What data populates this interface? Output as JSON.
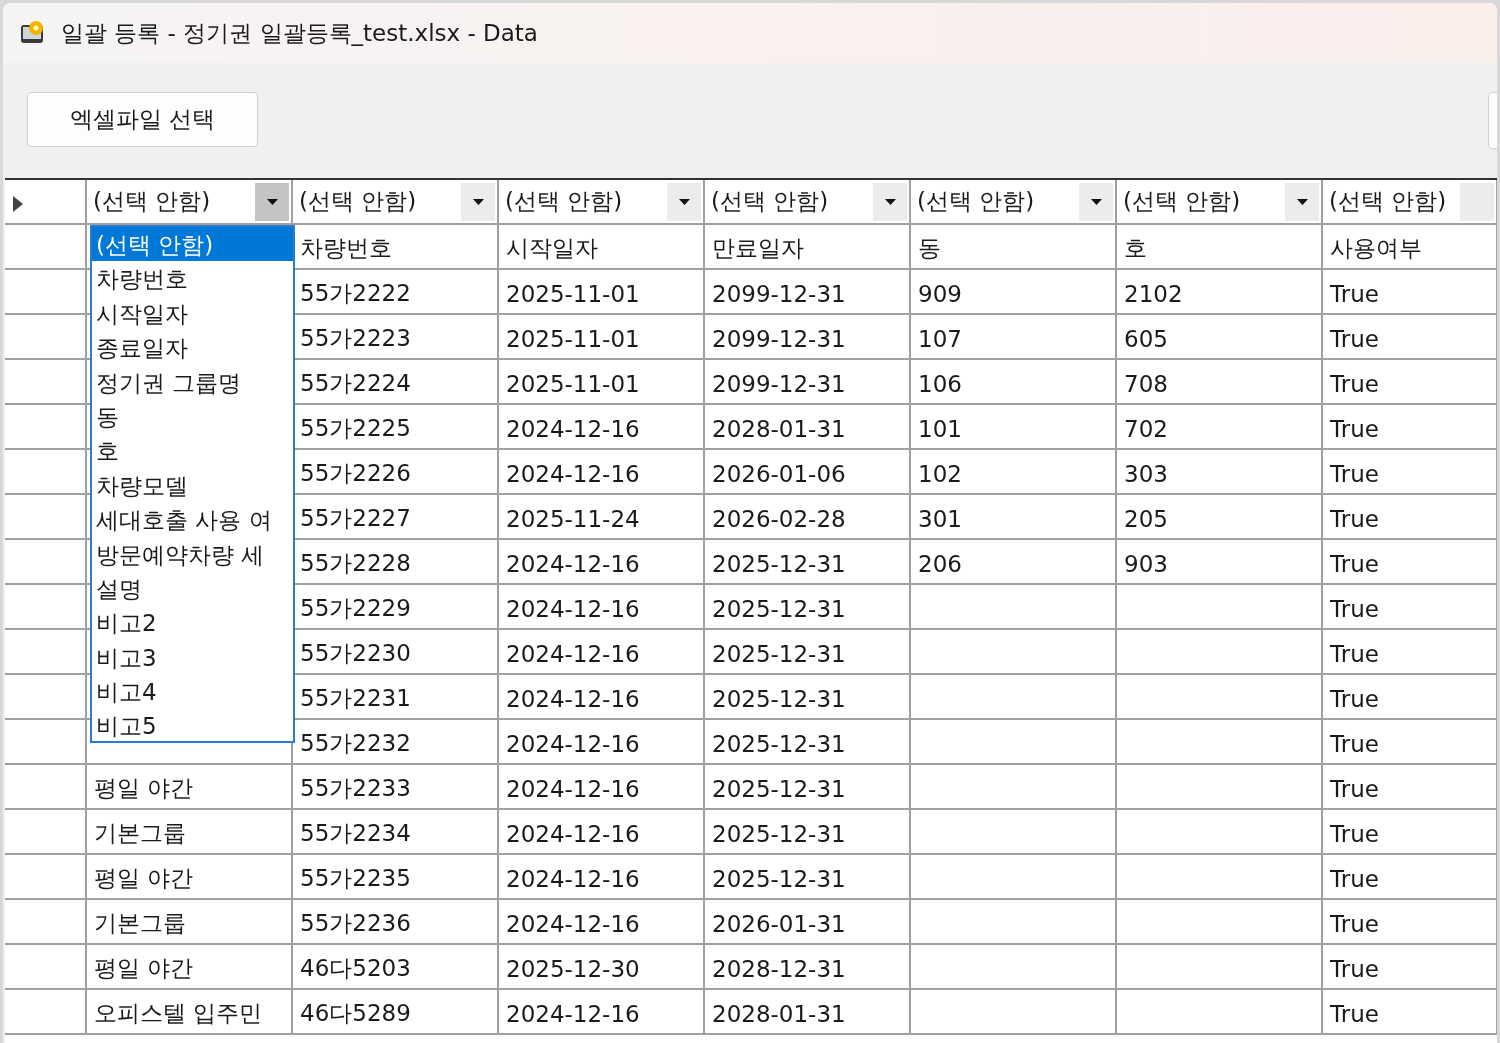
{
  "window": {
    "title": "일괄 등록 - 정기권 일괄등록_test.xlsx - Data"
  },
  "toolbar": {
    "button": "엑셀파일 선택"
  },
  "grid": {
    "combo_row": {
      "current": true,
      "combos": [
        {
          "text": "(선택 안함)",
          "open": true,
          "cut": false
        },
        {
          "text": "(선택 안함)",
          "open": false,
          "cut": false
        },
        {
          "text": "(선택 안함)",
          "open": false,
          "cut": false
        },
        {
          "text": "(선택 안함)",
          "open": false,
          "cut": false
        },
        {
          "text": "(선택 안함)",
          "open": false,
          "cut": false
        },
        {
          "text": "(선택 안함)",
          "open": false,
          "cut": false
        },
        {
          "text": "(선택 안함)",
          "open": false,
          "cut": true
        }
      ]
    },
    "rows": [
      {
        "cells": [
          "차량번호",
          "시작일자",
          "만료일자",
          "동",
          "호",
          "사용여부"
        ]
      },
      {
        "cells": [
          "55가2222",
          "2025-11-01",
          "2099-12-31",
          "909",
          "2102",
          "True"
        ]
      },
      {
        "cells": [
          "55가2223",
          "2025-11-01",
          "2099-12-31",
          "107",
          "605",
          "True"
        ]
      },
      {
        "cells": [
          "55가2224",
          "2025-11-01",
          "2099-12-31",
          "106",
          "708",
          "True"
        ]
      },
      {
        "cells": [
          "55가2225",
          "2024-12-16",
          "2028-01-31",
          "101",
          "702",
          "True"
        ]
      },
      {
        "cells": [
          "55가2226",
          "2024-12-16",
          "2026-01-06",
          "102",
          "303",
          "True"
        ]
      },
      {
        "cells": [
          "55가2227",
          "2025-11-24",
          "2026-02-28",
          "301",
          "205",
          "True"
        ]
      },
      {
        "cells": [
          "55가2228",
          "2024-12-16",
          "2025-12-31",
          "206",
          "903",
          "True"
        ]
      },
      {
        "cells": [
          "55가2229",
          "2024-12-16",
          "2025-12-31",
          null,
          null,
          "True"
        ]
      },
      {
        "cells": [
          "55가2230",
          "2024-12-16",
          "2025-12-31",
          null,
          null,
          "True"
        ]
      },
      {
        "cells": [
          "55가2231",
          "2024-12-16",
          "2025-12-31",
          null,
          null,
          "True"
        ]
      },
      {
        "cells": [
          "55가2232",
          "2024-12-16",
          "2025-12-31",
          null,
          null,
          "True"
        ]
      },
      {
        "group": "평일 야간",
        "cells": [
          "55가2233",
          "2024-12-16",
          "2025-12-31",
          null,
          null,
          "True"
        ]
      },
      {
        "group": "기본그룹",
        "cells": [
          "55가2234",
          "2024-12-16",
          "2025-12-31",
          null,
          null,
          "True"
        ]
      },
      {
        "group": "평일 야간",
        "cells": [
          "55가2235",
          "2024-12-16",
          "2025-12-31",
          null,
          null,
          "True"
        ]
      },
      {
        "group": "기본그룹",
        "cells": [
          "55가2236",
          "2024-12-16",
          "2026-01-31",
          null,
          null,
          "True"
        ]
      },
      {
        "group": "평일 야간",
        "cells": [
          "46다5203",
          "2025-12-30",
          "2028-12-31",
          null,
          null,
          "True"
        ]
      },
      {
        "group": "오피스텔 입주민",
        "cells": [
          "46다5289",
          "2024-12-16",
          "2028-01-31",
          null,
          null,
          "True"
        ]
      }
    ],
    "dropdown": {
      "items": [
        {
          "text": "(선택 안함)",
          "selected": true
        },
        {
          "text": "차량번호",
          "selected": false
        },
        {
          "text": "시작일자",
          "selected": false
        },
        {
          "text": "종료일자",
          "selected": false
        },
        {
          "text": "정기권 그룹명",
          "selected": false
        },
        {
          "text": "동",
          "selected": false
        },
        {
          "text": "호",
          "selected": false
        },
        {
          "text": "차량모델",
          "selected": false
        },
        {
          "text": "세대호출 사용 여",
          "selected": false
        },
        {
          "text": "방문예약차량 세",
          "selected": false
        },
        {
          "text": "설명",
          "selected": false
        },
        {
          "text": "비고2",
          "selected": false
        },
        {
          "text": "비고3",
          "selected": false
        },
        {
          "text": "비고4",
          "selected": false
        },
        {
          "text": "비고5",
          "selected": false
        }
      ]
    }
  }
}
